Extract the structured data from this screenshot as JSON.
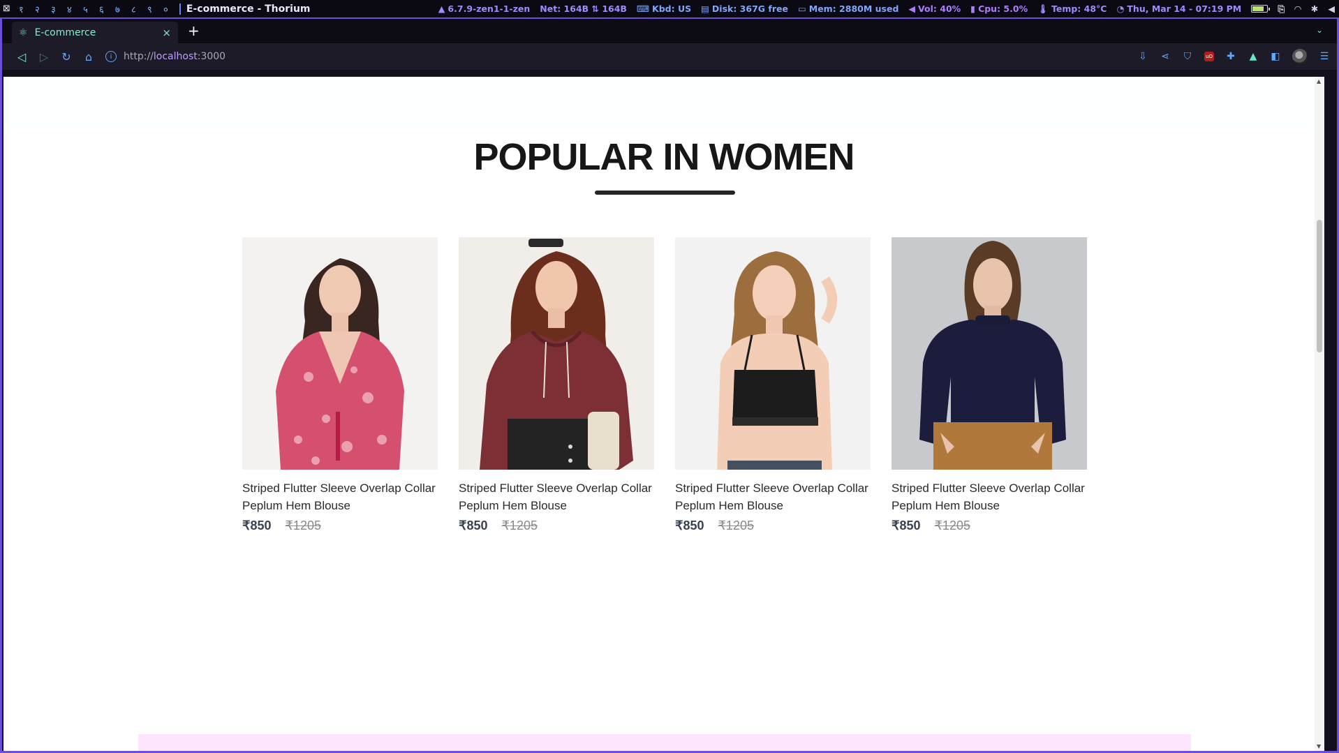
{
  "wm": {
    "workspaces": [
      "१",
      "२",
      "३",
      "४",
      "५",
      "६",
      "७",
      "८",
      "९",
      "०"
    ],
    "window_title": "E-commerce - Thorium",
    "kernel": "6.7.9-zen1-1-zen",
    "net": "Net: 164B ⇅ 164B",
    "kbd": "Kbd: US",
    "disk": "Disk: 367G free",
    "mem": "Mem:  2880M used",
    "vol": "Vol: 40%",
    "cpu": "Cpu: 5.0%",
    "temp": "Temp: 48°C",
    "datetime": "Thu, Mar 14 - 07:19 PM"
  },
  "browser": {
    "tab_label": "E-commerce",
    "url_scheme": "http://",
    "url_host": "localhost",
    "url_port": ":3000"
  },
  "page": {
    "section_title": "POPULAR IN WOMEN",
    "products": [
      {
        "name": "Striped Flutter Sleeve Overlap Collar Peplum Hem Blouse",
        "price_new": "₹850",
        "price_old": "₹1205"
      },
      {
        "name": "Striped Flutter Sleeve Overlap Collar Peplum Hem Blouse",
        "price_new": "₹850",
        "price_old": "₹1205"
      },
      {
        "name": "Striped Flutter Sleeve Overlap Collar Peplum Hem Blouse",
        "price_new": "₹850",
        "price_old": "₹1205"
      },
      {
        "name": "Striped Flutter Sleeve Overlap Collar Peplum Hem Blouse",
        "price_new": "₹850",
        "price_old": "₹1205"
      }
    ]
  }
}
